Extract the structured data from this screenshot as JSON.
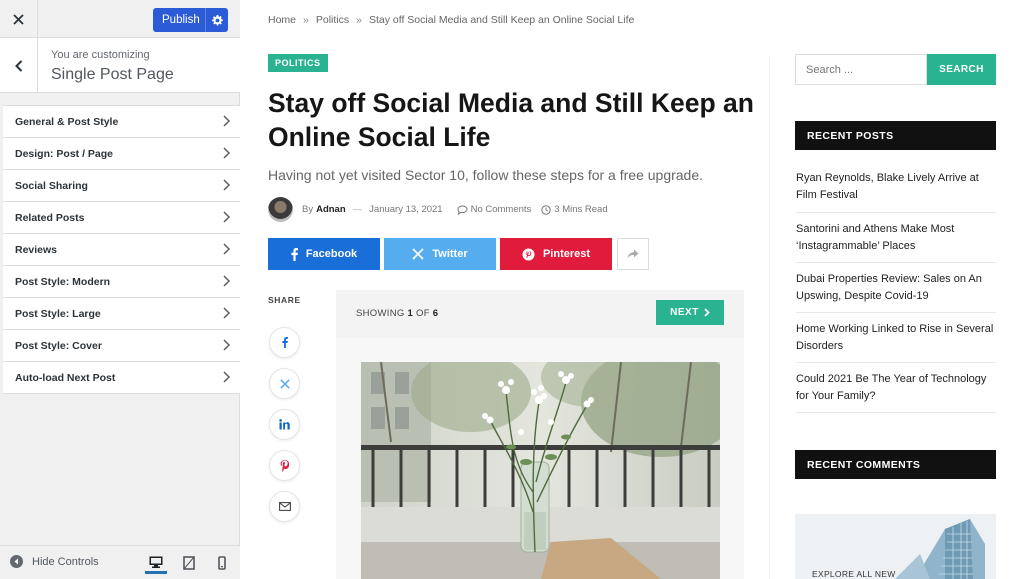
{
  "customizer": {
    "publish_label": "Publish",
    "customizing_label": "You are customizing",
    "section_title": "Single Post Page",
    "sections": [
      "General & Post Style",
      "Design: Post / Page",
      "Social Sharing",
      "Related Posts",
      "Reviews",
      "Post Style: Modern",
      "Post Style: Large",
      "Post Style: Cover",
      "Auto-load Next Post"
    ],
    "hide_controls_label": "Hide Controls",
    "accent_color": "#2c5bd8"
  },
  "breadcrumb": [
    "Home",
    "Politics",
    "Stay off Social Media and Still Keep an Online Social Life"
  ],
  "breadcrumb_separator": "»",
  "post": {
    "category": "POLITICS",
    "title": "Stay off Social Media and Still Keep an Online Social Life",
    "subtitle": "Having not yet visited Sector 10, follow these steps for a free upgrade.",
    "by_label": "By",
    "author": "Adnan",
    "date": "January 13, 2021",
    "comments": "No Comments",
    "read_time": "3 Mins Read"
  },
  "share": {
    "facebook": "Facebook",
    "twitter": "Twitter",
    "pinterest": "Pinterest",
    "share_label": "SHARE",
    "colors": {
      "facebook": "#1a6ed8",
      "twitter": "#55acee",
      "pinterest": "#e11b3c"
    }
  },
  "gallery": {
    "showing_label": "SHOWING",
    "current": "1",
    "of_label": "OF",
    "total": "6",
    "next_label": "NEXT"
  },
  "sidebar": {
    "search_placeholder": "Search ...",
    "search_button": "SEARCH",
    "recent_posts_title": "RECENT POSTS",
    "recent_posts": [
      "Ryan Reynolds, Blake Lively Arrive at Film Festival",
      "Santorini and Athens Make Most ‘Instagrammable’ Places",
      "Dubai Properties Review: Sales on An Upswing, Despite Covid-19",
      "Home Working Linked to Rise in Several Disorders",
      "Could 2021 Be The Year of Technology for Your Family?"
    ],
    "recent_comments_title": "RECENT COMMENTS",
    "image_caption": "EXPLORE ALL NEW"
  },
  "theme": {
    "accent": "#2ab391",
    "widget_title_bg": "#111111"
  }
}
